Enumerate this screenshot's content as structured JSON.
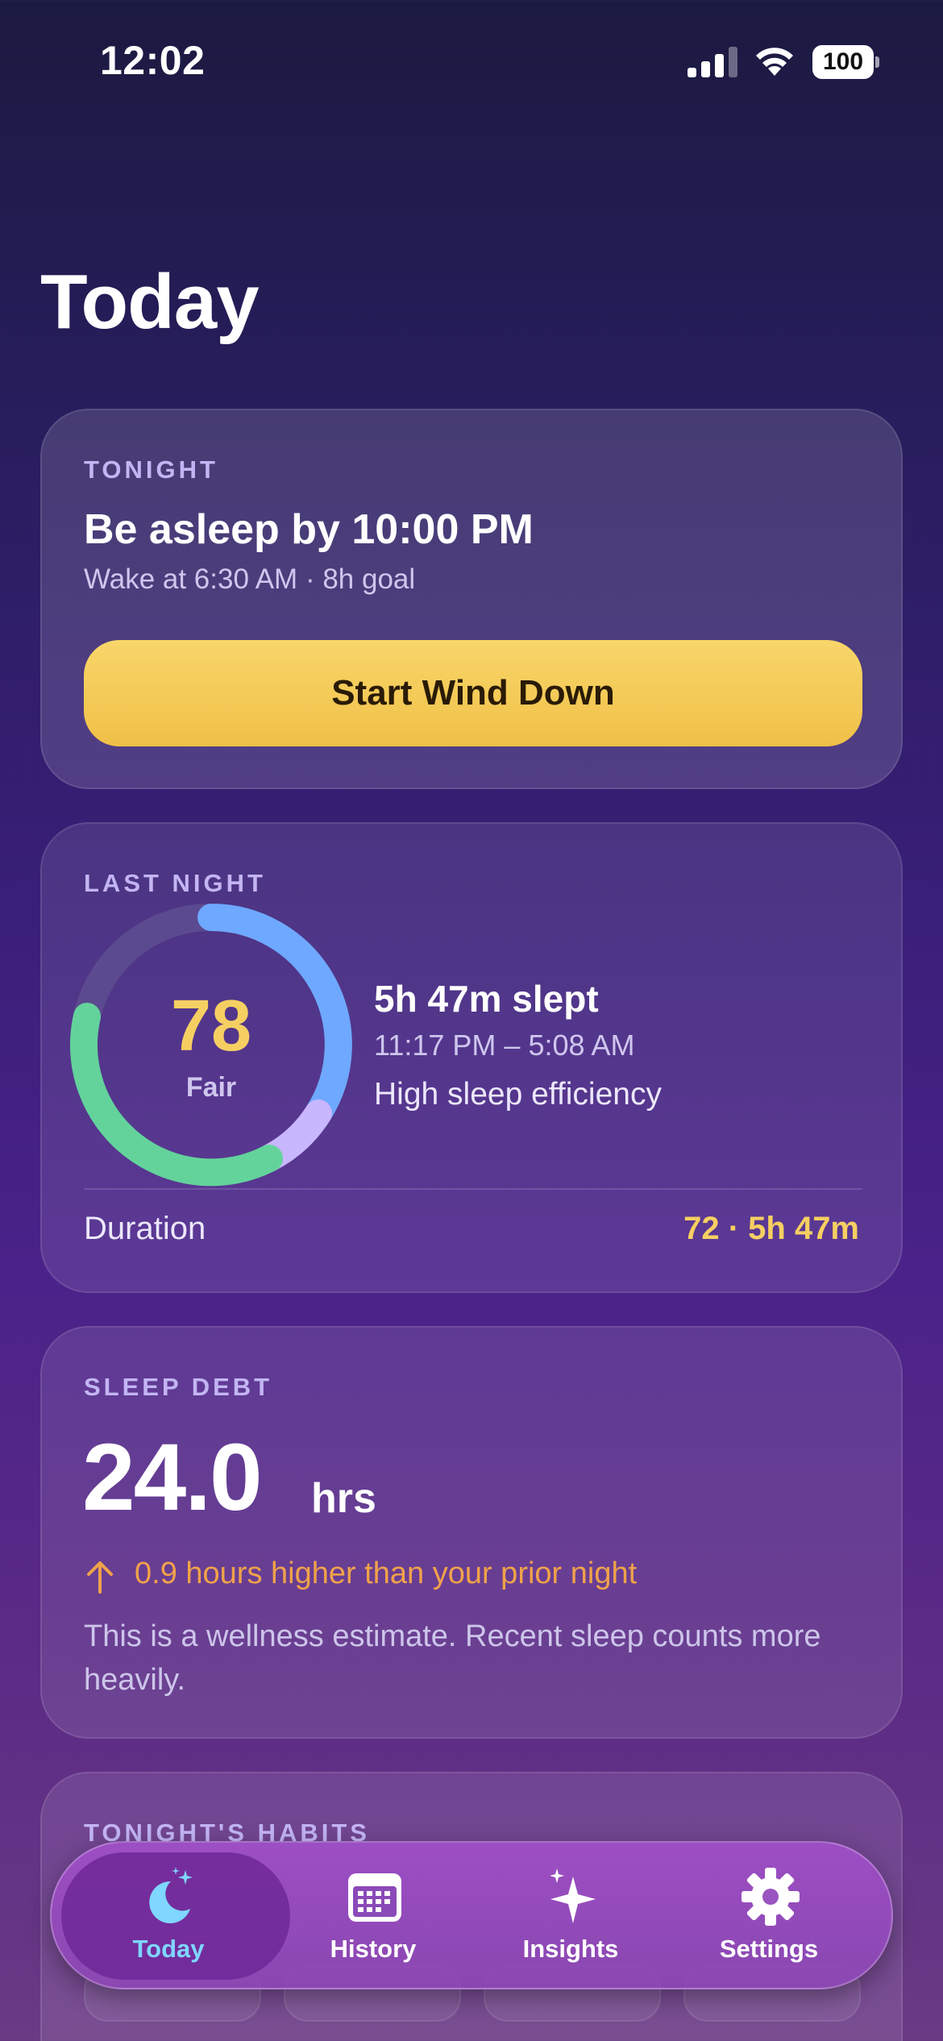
{
  "status_bar": {
    "time": "12:02",
    "battery": "100"
  },
  "page": {
    "title": "Today"
  },
  "tonight": {
    "label": "TONIGHT",
    "title": "Be asleep by 10:00 PM",
    "subtitle": "Wake at 6:30 AM · 8h goal",
    "button_label": "Start Wind Down"
  },
  "last_night": {
    "label": "LAST NIGHT",
    "score": "78",
    "score_label": "Fair",
    "slept": "5h 47m slept",
    "time_range": "11:17 PM – 5:08 AM",
    "note": "High sleep efficiency",
    "duration_label": "Duration",
    "duration_value": "72 · 5h 47m",
    "colors": {
      "blue": "#6ea8ff",
      "lavender": "#c8b6ff",
      "green": "#63d39b",
      "track": "#5b4a8f"
    }
  },
  "sleep_debt": {
    "label": "SLEEP DEBT",
    "value": "24.0",
    "unit": "hrs",
    "trend": "0.9 hours higher than your prior night",
    "note": "This is a wellness estimate. Recent sleep counts more heavily.",
    "trend_color": "#f0a24a"
  },
  "habits": {
    "label": "TONIGHT'S HABITS"
  },
  "tab_bar": {
    "items": [
      {
        "label": "Today",
        "icon": "moon-stars-icon",
        "selected": true
      },
      {
        "label": "History",
        "icon": "calendar-icon"
      },
      {
        "label": "Insights",
        "icon": "sparkles-icon"
      },
      {
        "label": "Settings",
        "icon": "gear-icon"
      }
    ]
  }
}
